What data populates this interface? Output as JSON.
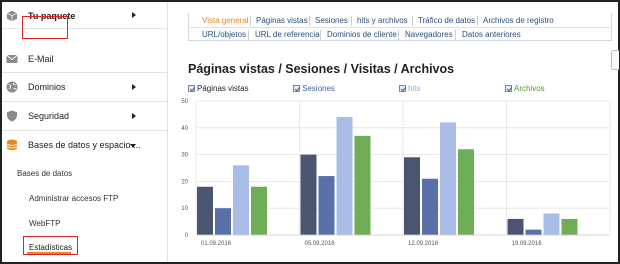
{
  "sidebar": {
    "items": [
      {
        "label": "Tu paquete",
        "icon": "package-icon",
        "arrow": "right"
      },
      {
        "label": "E-Mail",
        "icon": "envelope-icon",
        "arrow": ""
      },
      {
        "label": "Dominios",
        "icon": "globe-icon",
        "arrow": "right"
      },
      {
        "label": "Seguridad",
        "icon": "shield-icon",
        "arrow": "right"
      },
      {
        "label": "Bases de datos y espacio ...",
        "icon": "database-icon",
        "arrow": "down"
      }
    ],
    "subitems": [
      {
        "label": "Bases de datos"
      },
      {
        "label": "Administrar accesos FTP"
      },
      {
        "label": "WebFTP"
      },
      {
        "label": "Estadísticas"
      }
    ],
    "highlight_color": "#d22222",
    "active_underline_color": "#e68a1e"
  },
  "tabs": {
    "row1": [
      "Vista general",
      "Páginas vistas",
      "Sesiones",
      "hits y archivos",
      "Tráfico de datos",
      "Archivos de registro"
    ],
    "row2": [
      "URL/objetos",
      "URL de referencia",
      "Dominios de cliente",
      "Navegadores",
      "Datos anteriores"
    ],
    "active": "Vista general",
    "active_color": "#e68a1e"
  },
  "page": {
    "title": "Páginas vistas / Sesiones / Visitas / Archivos"
  },
  "legend": [
    {
      "label": "Páginas vistas",
      "color": "#222222",
      "checked": true
    },
    {
      "label": "Sesiones",
      "color": "#3f64a8",
      "checked": true
    },
    {
      "label": "hits",
      "color": "#8fa8d8",
      "checked": true
    },
    {
      "label": "Archivos",
      "color": "#4f9a2f",
      "checked": true
    }
  ],
  "chart_data": {
    "type": "bar",
    "categories": [
      "01.09.2016",
      "05.09.2016",
      "12.09.2016",
      "19.09.2016"
    ],
    "series": [
      {
        "name": "Páginas vistas",
        "values": [
          18,
          30,
          29,
          6
        ],
        "color": "#4a5670"
      },
      {
        "name": "Sesiones",
        "values": [
          10,
          22,
          21,
          2
        ],
        "color": "#5a70a8"
      },
      {
        "name": "hits",
        "values": [
          26,
          44,
          42,
          8
        ],
        "color": "#a9bde6"
      },
      {
        "name": "Archivos",
        "values": [
          18,
          37,
          32,
          6
        ],
        "color": "#6fae57"
      }
    ],
    "yticks": [
      0,
      10,
      20,
      30,
      40,
      50
    ],
    "ylim": [
      0,
      50
    ],
    "grid": true,
    "title": "",
    "xlabel": "",
    "ylabel": ""
  }
}
